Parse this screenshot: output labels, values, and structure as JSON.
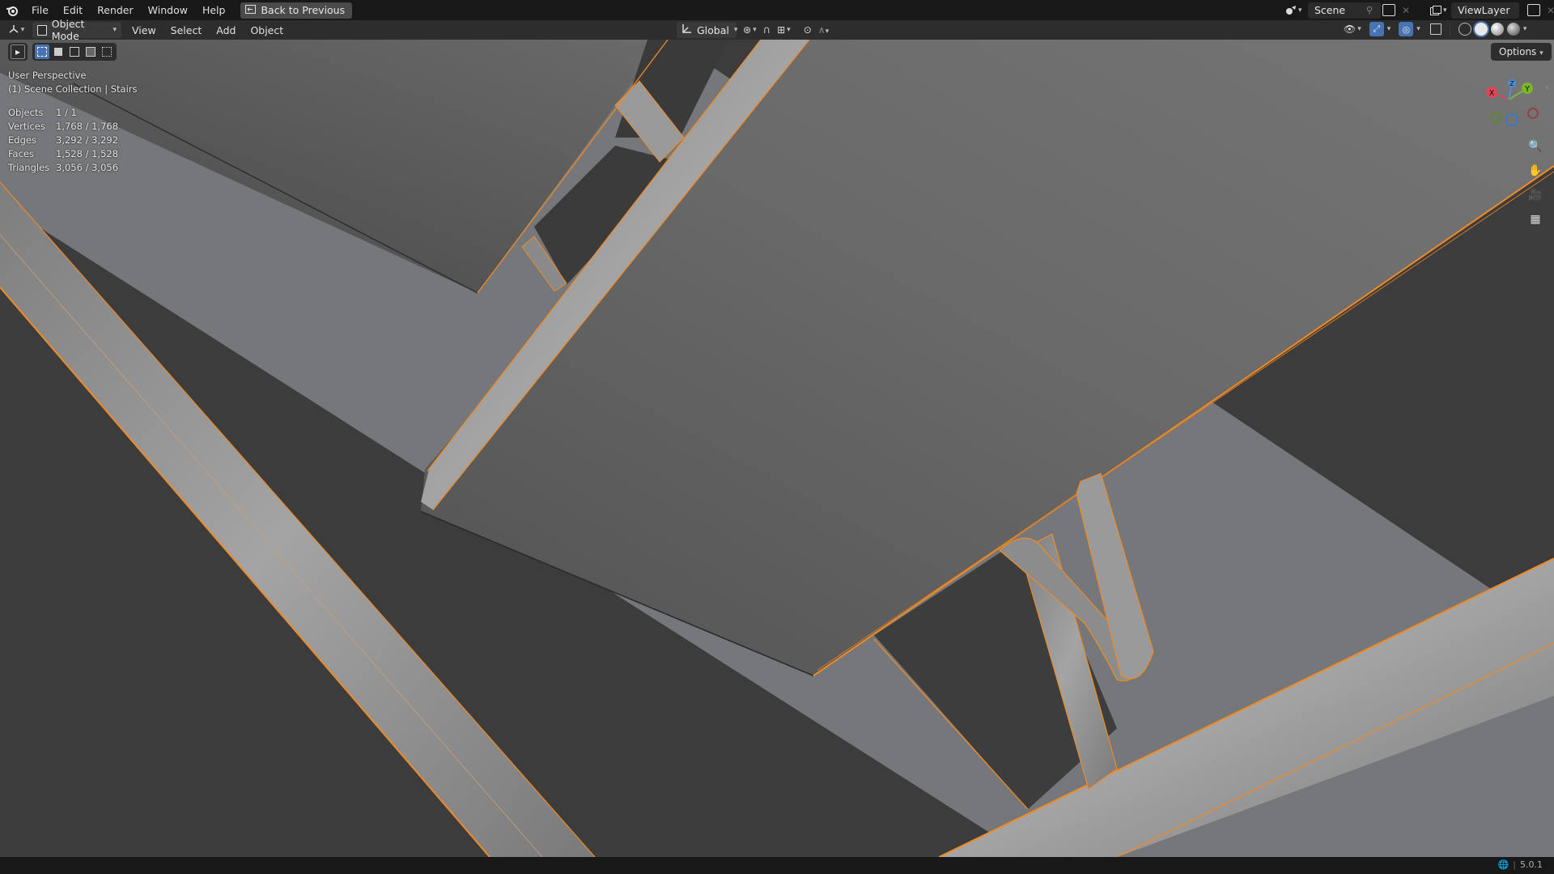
{
  "topbar": {
    "menus": [
      "File",
      "Edit",
      "Render",
      "Window",
      "Help"
    ],
    "back_button": "Back to Previous",
    "scene": "Scene",
    "view_layer": "ViewLayer"
  },
  "header": {
    "mode": "Object Mode",
    "menus": [
      "View",
      "Select",
      "Add",
      "Object"
    ],
    "transform_orientation": "Global",
    "options_label": "Options"
  },
  "viewport": {
    "perspective": "User Perspective",
    "collection": "(1) Scene Collection | Stairs",
    "stats": [
      {
        "label": "Objects",
        "value": "1 / 1"
      },
      {
        "label": "Vertices",
        "value": "1,768 / 1,768"
      },
      {
        "label": "Edges",
        "value": "3,292 / 3,292"
      },
      {
        "label": "Faces",
        "value": "1,528 / 1,528"
      },
      {
        "label": "Triangles",
        "value": "3,056 / 3,056"
      }
    ],
    "gizmo": {
      "x": "X",
      "y": "Y",
      "z": "Z"
    },
    "selection_color": "#f08a24"
  },
  "status": {
    "version": "5.0.1"
  }
}
